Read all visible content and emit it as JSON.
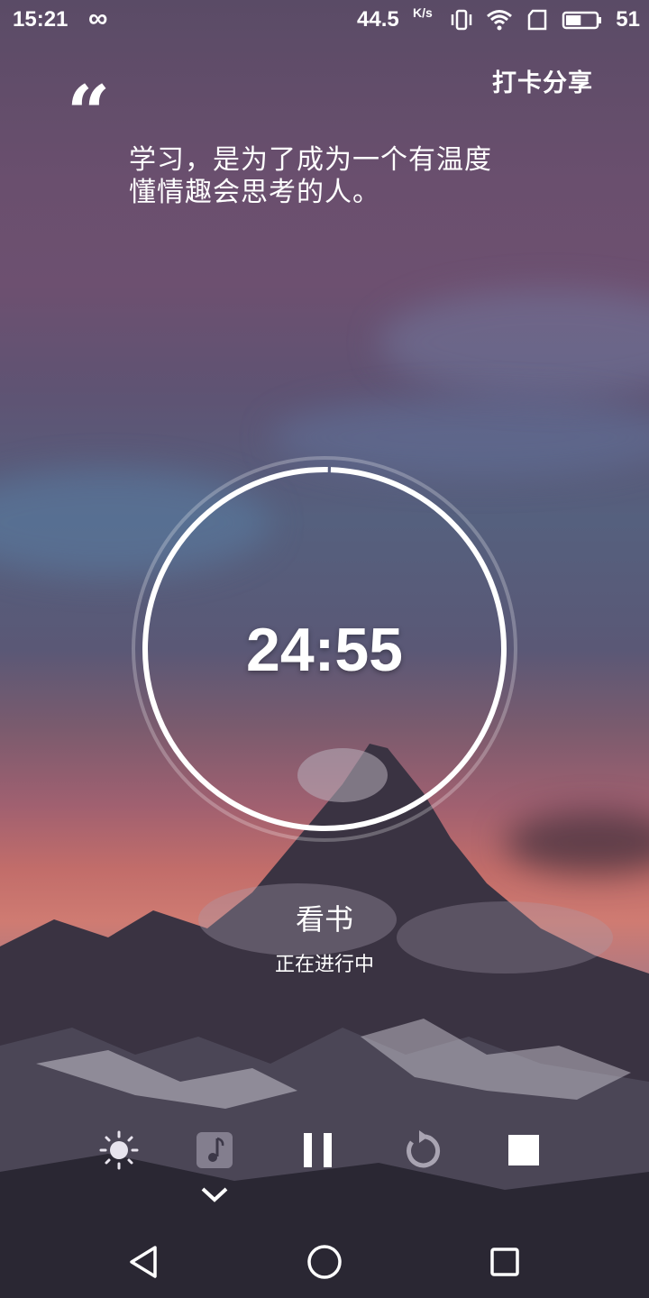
{
  "status_bar": {
    "time": "15:21",
    "infinity_symbol": "∞",
    "net_speed": "44.5",
    "net_unit": "K/s",
    "battery_level": "51",
    "icons": [
      "vibrate-icon",
      "wifi-icon",
      "sim-icon",
      "battery-icon"
    ]
  },
  "header": {
    "share_label": "打卡分享"
  },
  "quote": {
    "mark": "“",
    "line1": "学习，是为了成为一个有温度",
    "line2": "懂情趣会思考的人。"
  },
  "timer": {
    "display": "24:55",
    "progress": 0.997
  },
  "task": {
    "name": "看书",
    "status": "正在进行中"
  },
  "controls": {
    "items": [
      "brightness-icon",
      "music-icon",
      "pause-icon",
      "restart-icon",
      "stop-icon",
      "chevron-down-icon"
    ]
  },
  "navigation": {
    "items": [
      "back-icon",
      "home-icon",
      "recents-icon"
    ]
  },
  "colors": {
    "text": "#ffffff",
    "ring": "#ffffff"
  }
}
